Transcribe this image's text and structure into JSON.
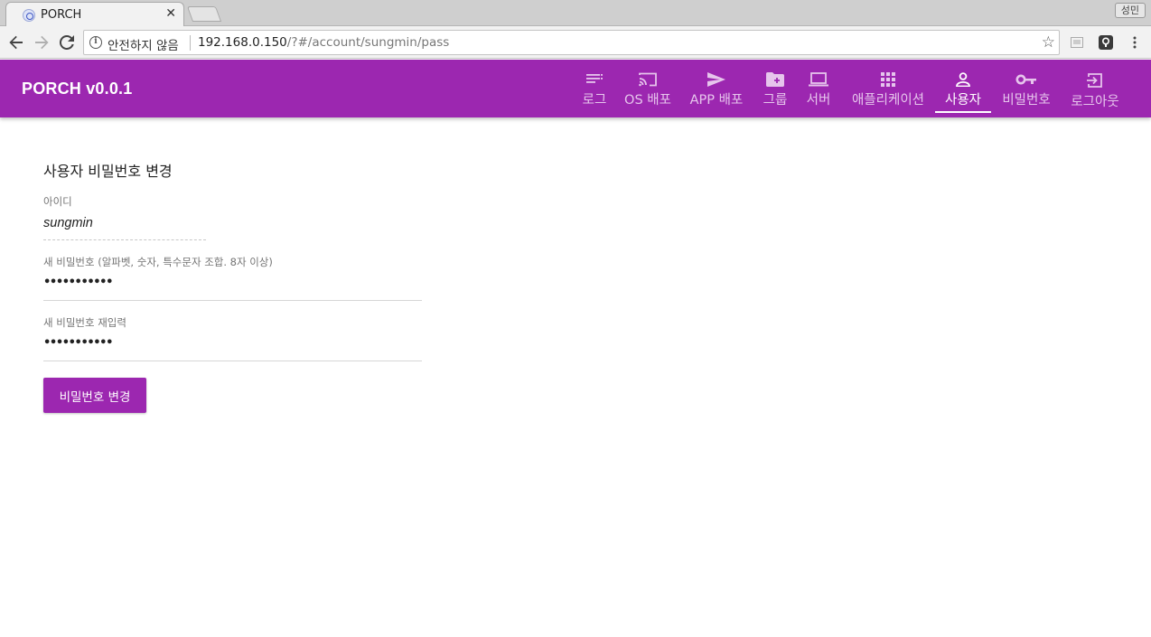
{
  "browser": {
    "tab_title": "PORCH",
    "profile_name": "성민",
    "security_label": "안전하지 않음",
    "url_host": "192.168.0.150",
    "url_path": "/?#/account/sungmin/pass"
  },
  "appbar": {
    "brand": "PORCH v0.0.1",
    "color": "#9c27b0",
    "nav": [
      {
        "label": "로그",
        "icon": "list-icon"
      },
      {
        "label": "OS 배포",
        "icon": "cast-icon"
      },
      {
        "label": "APP 배포",
        "icon": "send-icon"
      },
      {
        "label": "그룹",
        "icon": "folder-add-icon"
      },
      {
        "label": "서버",
        "icon": "laptop-icon"
      },
      {
        "label": "애플리케이션",
        "icon": "apps-grid-icon"
      },
      {
        "label": "사용자",
        "icon": "person-icon",
        "active": true
      },
      {
        "label": "비밀번호",
        "icon": "key-icon"
      },
      {
        "label": "로그아웃",
        "icon": "logout-icon"
      }
    ]
  },
  "form": {
    "title": "사용자 비밀번호 변경",
    "id_label": "아이디",
    "id_value": "sungmin",
    "new_password_label": "새 비밀번호 (알파벳, 숫자, 특수문자 조합. 8자 이상)",
    "new_password_mask": "•••••••••••",
    "confirm_password_label": "새 비밀번호 재입력",
    "confirm_password_mask": "•••••••••••",
    "submit_label": "비밀번호 변경"
  }
}
